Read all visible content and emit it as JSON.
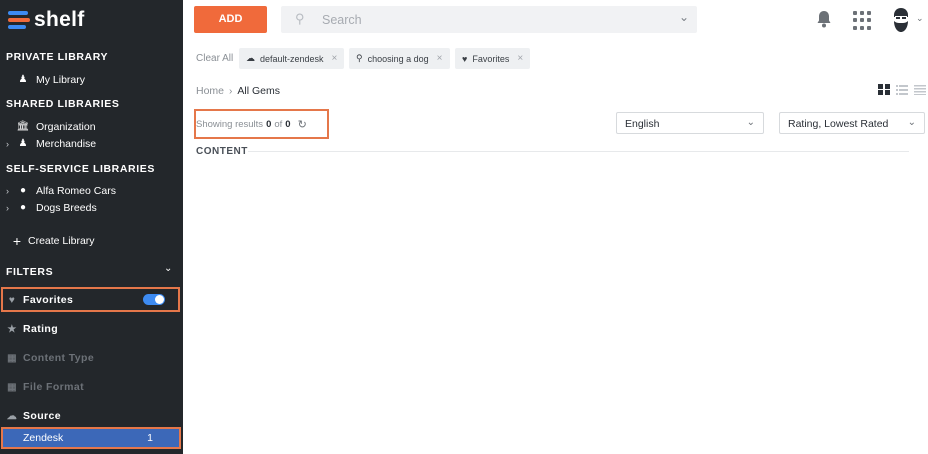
{
  "app": {
    "logo_text": "shelf"
  },
  "sidebar": {
    "private_title": "PRIVATE LIBRARY",
    "my_library": "My Library",
    "shared_title": "SHARED LIBRARIES",
    "shared_items": [
      {
        "label": "Organization",
        "icon": "building-icon"
      },
      {
        "label": "Merchandise",
        "icon": "user-group-icon"
      }
    ],
    "self_service_title": "SELF-SERVICE LIBRARIES",
    "self_service_items": [
      {
        "label": "Alfa Romeo Cars",
        "icon": "globe-icon"
      },
      {
        "label": "Dogs Breeds",
        "icon": "globe-icon"
      }
    ],
    "create_library": "Create Library",
    "filters_title": "FILTERS",
    "filters": {
      "favorites": "Favorites",
      "favorites_enabled": true,
      "rating": "Rating",
      "content_type": "Content Type",
      "file_format": "File Format",
      "source": "Source"
    },
    "source_option": {
      "label": "Zendesk",
      "count": "1"
    }
  },
  "toolbar": {
    "add_label": "ADD",
    "search_placeholder": "Search"
  },
  "active_filters": {
    "clear_all": "Clear All",
    "chips": [
      {
        "label": "default-zendesk",
        "icon": "cloud-icon"
      },
      {
        "label": "choosing a dog",
        "icon": "search-icon"
      },
      {
        "label": "Favorites",
        "icon": "heart-icon"
      }
    ]
  },
  "breadcrumb": {
    "home": "Home",
    "separator": "›",
    "current": "All Gems"
  },
  "results": {
    "prefix": "Showing results",
    "shown": "0",
    "of": "of",
    "total": "0"
  },
  "language_select": {
    "value": "English"
  },
  "sort_select": {
    "value": "Rating, Lowest Rated"
  },
  "content_label": "CONTENT",
  "colors": {
    "sidebar_bg": "#23272b",
    "accent": "#f06a3b",
    "brand_blue": "#3d8bf2",
    "selected_bg": "#3c68b8",
    "highlight_border": "#e5774a"
  }
}
